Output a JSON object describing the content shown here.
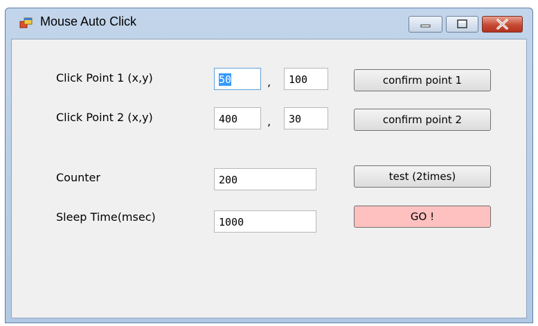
{
  "window": {
    "title": "Mouse Auto Click",
    "icon": "app-window-icon",
    "controls": [
      "minimize-icon",
      "maximize-icon",
      "close-icon"
    ]
  },
  "form": {
    "point1": {
      "label": "Click Point 1 (x,y)",
      "x": "50",
      "separator": ",",
      "y": "100",
      "button": "confirm point 1"
    },
    "point2": {
      "label": "Click Point 2 (x,y)",
      "x": "400",
      "separator": ",",
      "y": "30",
      "button": "confirm point 2"
    },
    "counter": {
      "label": "Counter",
      "value": "200",
      "button": "test (2times)"
    },
    "sleep": {
      "label": "Sleep Time(msec)",
      "value": "1000",
      "button": "GO !"
    }
  },
  "colors": {
    "go_button": "#ffc0c0",
    "selection": "#3399ff",
    "close_button": "#c64a34"
  }
}
